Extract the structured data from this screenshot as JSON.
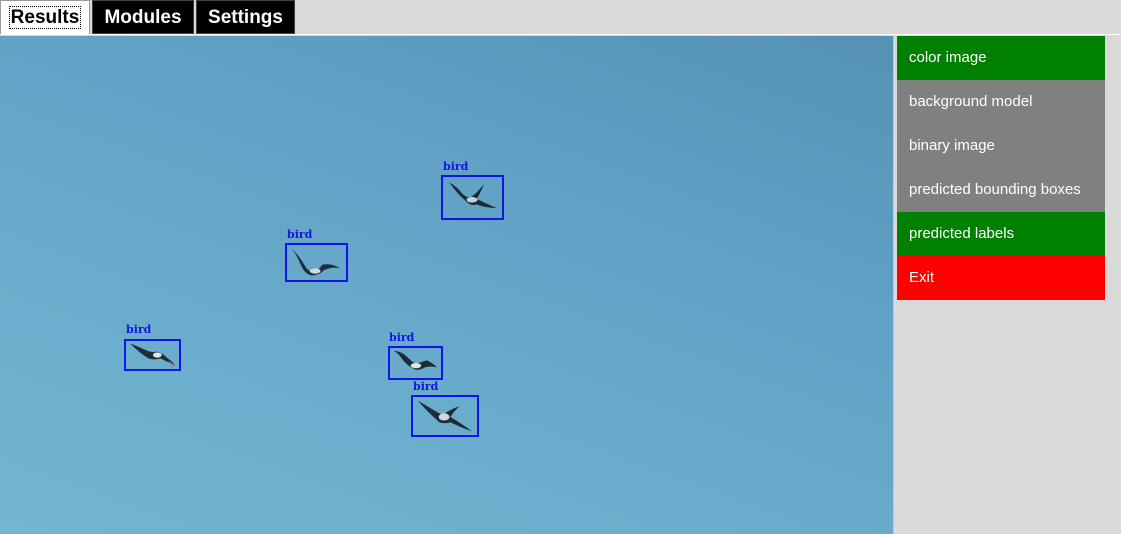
{
  "tabs": [
    {
      "label": "Results",
      "active": true
    },
    {
      "label": "Modules",
      "active": false
    },
    {
      "label": "Settings",
      "active": false
    }
  ],
  "detections": [
    {
      "label": "bird"
    },
    {
      "label": "bird"
    },
    {
      "label": "bird"
    },
    {
      "label": "bird"
    },
    {
      "label": "bird"
    }
  ],
  "panel": {
    "buttons": [
      {
        "label": "color image",
        "state": "on",
        "color": "#008000"
      },
      {
        "label": "background model",
        "state": "off",
        "color": "#808080"
      },
      {
        "label": "binary image",
        "state": "off",
        "color": "#808080"
      },
      {
        "label": "predicted bounding boxes",
        "state": "off",
        "color": "#808080"
      },
      {
        "label": "predicted labels",
        "state": "on",
        "color": "#008000"
      },
      {
        "label": "Exit",
        "state": "exit",
        "color": "#ff0000"
      }
    ]
  },
  "colors": {
    "box": "#1414e6",
    "on": "#008000",
    "off": "#808080",
    "exit": "#ff0000"
  }
}
